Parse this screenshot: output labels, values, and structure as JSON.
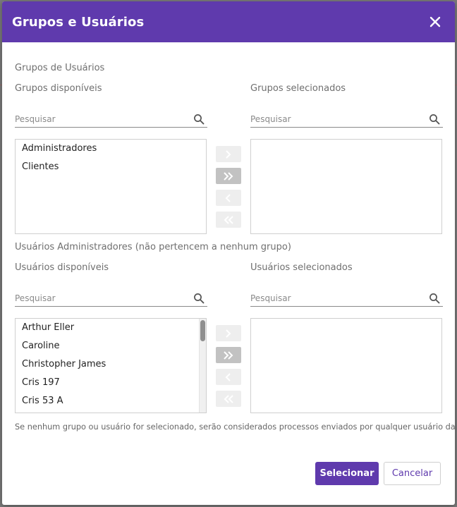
{
  "dialog": {
    "title": "Grupos e Usuários",
    "header_color": "#5f3aad"
  },
  "groups_section": {
    "title": "Grupos de Usuários",
    "available_label": "Grupos disponíveis",
    "selected_label": "Grupos selecionados",
    "available_search_placeholder": "Pesquisar",
    "selected_search_placeholder": "Pesquisar",
    "available_items": [
      "Administradores",
      "Clientes"
    ],
    "selected_items": []
  },
  "users_section": {
    "title": "Usuários Administradores (não pertencem a nenhum grupo)",
    "available_label": "Usuários disponíveis",
    "selected_label": "Usuários selecionados",
    "available_search_placeholder": "Pesquisar",
    "selected_search_placeholder": "Pesquisar",
    "available_items": [
      "Arthur Eller",
      "Caroline",
      "Christopher James",
      "Cris 197",
      "Cris 53 A"
    ],
    "selected_items": []
  },
  "transfer_icons": [
    "chevron-right-icon",
    "double-chevron-right-icon",
    "chevron-left-icon",
    "double-chevron-left-icon"
  ],
  "footnote": "Se nenhum grupo ou usuário for selecionado, serão considerados processos enviados por qualquer usuário da conta.",
  "actions": {
    "select_label": "Selecionar",
    "cancel_label": "Cancelar"
  }
}
